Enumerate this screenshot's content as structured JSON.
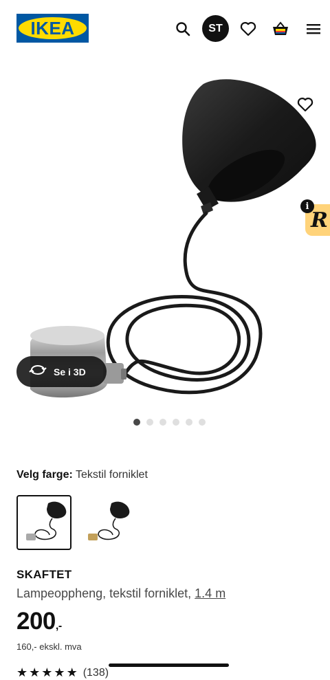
{
  "header": {
    "logo_text": "IKEA",
    "avatar_initials": "ST",
    "icons": [
      "search-icon",
      "heart-icon",
      "basket-icon",
      "menu-icon"
    ],
    "brand_blue": "#0058a3",
    "brand_yellow": "#ffdb00"
  },
  "hero": {
    "view_3d_label": "Se i 3D",
    "carousel": {
      "total": 6,
      "active": 0
    },
    "badge_letter": "R",
    "badge_info": "i"
  },
  "product": {
    "color_label": "Velg farge:",
    "color_value": "Tekstil forniklet",
    "swatches": [
      "Tekstil forniklet",
      "Tekstil messing"
    ],
    "name": "SKAFTET",
    "description": "Lampeoppheng, tekstil forniklet,",
    "size_link": "1.4 m",
    "price": "200",
    "price_suffix": ",-",
    "price_ex_vat": "160,- ekskl. mva",
    "rating_stars": 5,
    "rating_count": "(138)"
  }
}
